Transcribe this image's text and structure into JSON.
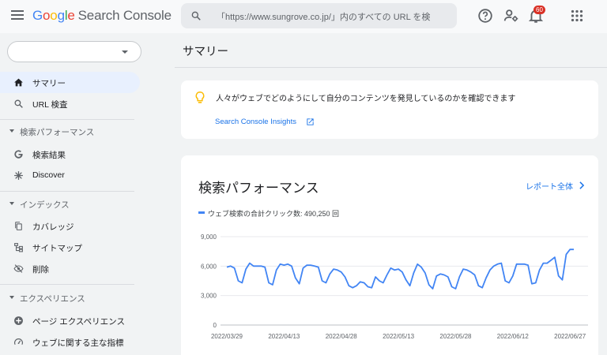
{
  "header": {
    "logo_google": "Google",
    "logo_product": "Search Console",
    "search_placeholder": "「https://www.sungrove.co.jp/」内のすべての URL を検",
    "notification_count": "60",
    "icons": [
      "menu-icon",
      "search-icon",
      "help-icon",
      "manage-users-icon",
      "notifications-icon",
      "apps-grid-icon"
    ]
  },
  "sidebar": {
    "property_value": "",
    "items": [
      {
        "label": "サマリー",
        "icon": "home-icon",
        "active": true
      },
      {
        "label": "URL 検査",
        "icon": "search-icon"
      }
    ],
    "sections": [
      {
        "title": "検索パフォーマンス",
        "items": [
          {
            "label": "検索結果",
            "icon": "google-g-icon"
          },
          {
            "label": "Discover",
            "icon": "discover-asterisk-icon"
          }
        ]
      },
      {
        "title": "インデックス",
        "items": [
          {
            "label": "カバレッジ",
            "icon": "coverage-copy-icon"
          },
          {
            "label": "サイトマップ",
            "icon": "sitemap-icon"
          },
          {
            "label": "削除",
            "icon": "eye-off-icon"
          }
        ]
      },
      {
        "title": "エクスペリエンス",
        "items": [
          {
            "label": "ページ エクスペリエンス",
            "icon": "page-experience-icon"
          },
          {
            "label": "ウェブに関する主な指標",
            "icon": "speed-gauge-icon"
          }
        ]
      }
    ]
  },
  "main": {
    "page_title": "サマリー",
    "insights": {
      "text": "人々がウェブでどのようにして自分のコンテンツを発見しているのかを確認できます",
      "link": "Search Console Insights"
    },
    "performance": {
      "title": "検索パフォーマンス",
      "report_link": "レポート全体",
      "legend": "ウェブ検索の合計クリック数: 490,250 回"
    }
  },
  "colors": {
    "accent": "#1a73e8",
    "series": "#4285f4",
    "active_nav": "#e8f0fe",
    "badge": "#d93025",
    "bulb": "#fbbc04"
  },
  "chart_data": {
    "type": "line",
    "title": "",
    "xlabel": "",
    "ylabel": "",
    "ylim": [
      0,
      9000
    ],
    "y_ticks": [
      "9,000",
      "6,000",
      "3,000",
      "0"
    ],
    "y_tick_values": [
      9000,
      6000,
      3000,
      0
    ],
    "x_tick_labels": [
      "2022/03/29",
      "2022/04/13",
      "2022/04/28",
      "2022/05/13",
      "2022/05/28",
      "2022/06/12",
      "2022/06/27"
    ],
    "x_tick_indices": [
      0,
      15,
      30,
      45,
      60,
      75,
      90
    ],
    "grid": true,
    "series": [
      {
        "name": "ウェブ検索の合計クリック数",
        "values": [
          5900,
          6000,
          5800,
          4500,
          4300,
          5700,
          6300,
          6000,
          6000,
          6000,
          5900,
          4300,
          4100,
          5600,
          6200,
          6100,
          6200,
          6000,
          4800,
          4200,
          5800,
          6100,
          6100,
          6000,
          5900,
          4500,
          4300,
          5200,
          5700,
          5600,
          5400,
          4900,
          4000,
          3800,
          4000,
          4400,
          4300,
          3900,
          3800,
          4900,
          4500,
          4300,
          5100,
          5800,
          5600,
          5700,
          5400,
          4600,
          4000,
          5300,
          6200,
          5900,
          5300,
          4100,
          3700,
          5000,
          5200,
          5100,
          4900,
          3900,
          3700,
          4900,
          5700,
          5600,
          5400,
          5100,
          4000,
          3800,
          4800,
          5600,
          6000,
          6200,
          6300,
          4500,
          4300,
          5000,
          6200,
          6200,
          6200,
          6100,
          4200,
          4300,
          5600,
          6300,
          6300,
          6600,
          6900,
          5000,
          4600,
          7200,
          7700,
          7700
        ]
      }
    ]
  }
}
